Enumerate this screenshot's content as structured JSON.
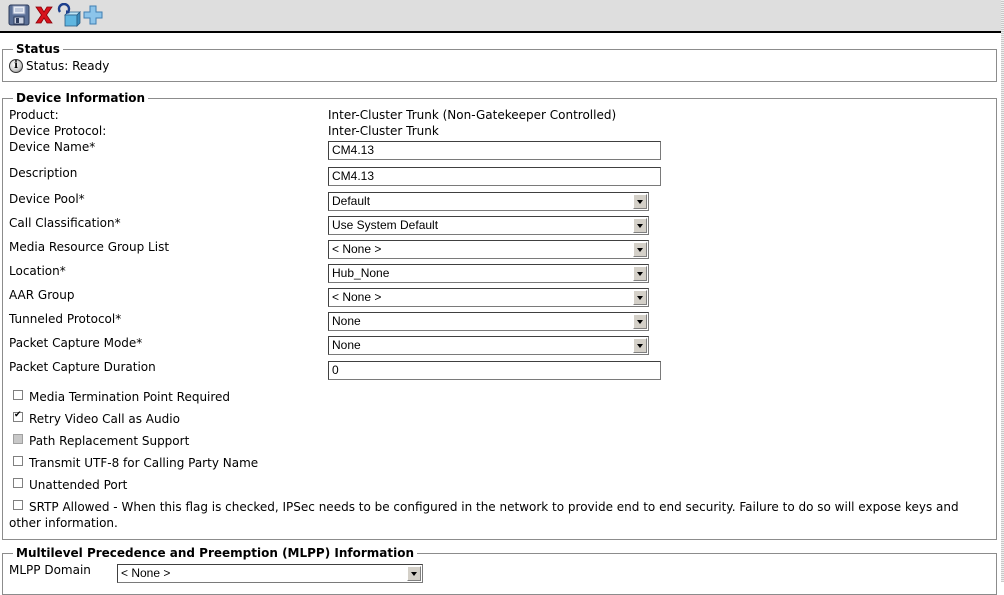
{
  "toolbar": {
    "buttons": [
      {
        "name": "save",
        "icon": "floppy-disk-icon"
      },
      {
        "name": "delete",
        "icon": "red-x-icon"
      },
      {
        "name": "reset",
        "icon": "reset-cube-icon"
      },
      {
        "name": "add-new",
        "icon": "blue-plus-icon"
      }
    ]
  },
  "status": {
    "legend": "Status",
    "icon": "info-icon",
    "icon_glyph": "i",
    "text": "Status: Ready"
  },
  "device_info": {
    "legend": "Device Information",
    "product_label": "Product:",
    "product_value": "Inter-Cluster Trunk (Non-Gatekeeper Controlled)",
    "protocol_label": "Device Protocol:",
    "protocol_value": "Inter-Cluster Trunk",
    "fields": {
      "device_name": {
        "label": "Device Name*",
        "value": "CM4.13"
      },
      "description": {
        "label": "Description",
        "value": "CM4.13"
      },
      "device_pool": {
        "label": "Device Pool*",
        "value": "Default"
      },
      "call_classification": {
        "label": "Call Classification*",
        "value": "Use System Default"
      },
      "mrgl": {
        "label": "Media Resource Group List",
        "value": "< None >"
      },
      "location": {
        "label": "Location*",
        "value": "Hub_None"
      },
      "aar_group": {
        "label": "AAR Group",
        "value": "< None >"
      },
      "tunneled_protocol": {
        "label": "Tunneled Protocol*",
        "value": "None"
      },
      "packet_capture_mode": {
        "label": "Packet Capture Mode*",
        "value": "None"
      },
      "packet_capture_duration": {
        "label": "Packet Capture Duration",
        "value": "0"
      }
    },
    "checkboxes": [
      {
        "label": "Media Termination Point Required",
        "checked": false,
        "disabled": false
      },
      {
        "label": "Retry Video Call as Audio",
        "checked": true,
        "disabled": false
      },
      {
        "label": "Path Replacement Support",
        "checked": false,
        "disabled": true
      },
      {
        "label": "Transmit UTF-8 for Calling Party Name",
        "checked": false,
        "disabled": false
      },
      {
        "label": "Unattended Port",
        "checked": false,
        "disabled": false
      },
      {
        "label": "SRTP Allowed - When this flag is checked, IPSec needs to be configured in the network to provide end to end security. Failure to do so will expose keys and other information.",
        "checked": false,
        "disabled": false
      }
    ]
  },
  "mlpp": {
    "legend": "Multilevel Precedence and Preemption (MLPP) Information",
    "domain_label": "MLPP Domain",
    "domain_value": "< None >"
  }
}
